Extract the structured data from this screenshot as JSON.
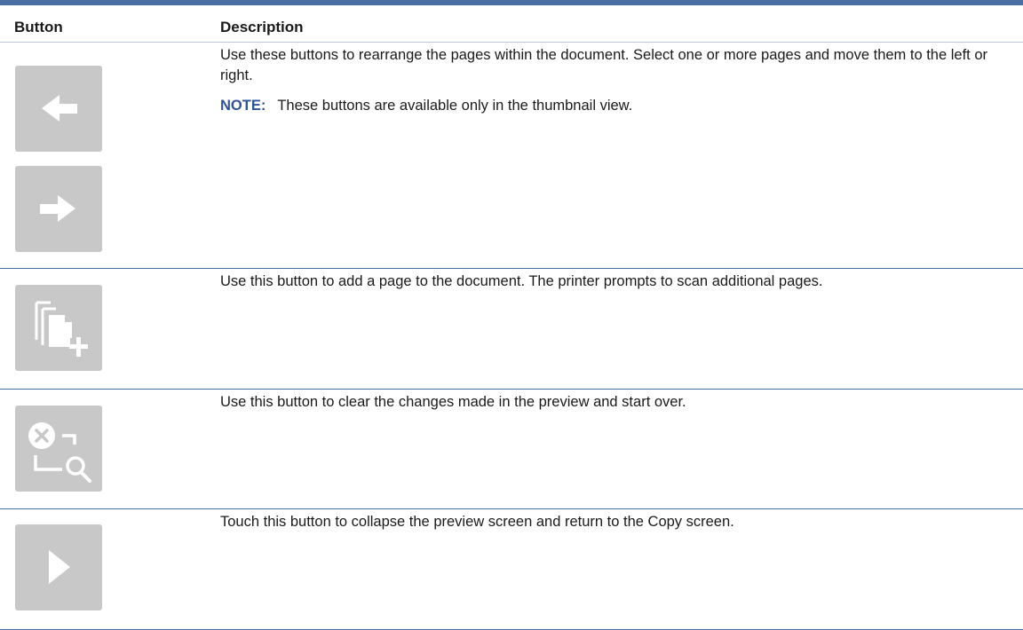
{
  "table": {
    "header": {
      "button_col": "Button",
      "description_col": "Description"
    },
    "rows": [
      {
        "icons": [
          "arrow-left-icon",
          "arrow-right-icon"
        ],
        "description": "Use these buttons to rearrange the pages within the document. Select one or more pages and move them to the left or right.",
        "note_label": "NOTE:",
        "note_text": "These buttons are available only in the thumbnail view."
      },
      {
        "icons": [
          "add-page-icon"
        ],
        "description": "Use this button to add a page to the document. The printer prompts to scan additional pages."
      },
      {
        "icons": [
          "reset-preview-icon"
        ],
        "description": "Use this button to clear the changes made in the preview and start over."
      },
      {
        "icons": [
          "collapse-play-icon"
        ],
        "description": "Touch this button to collapse the preview screen and return to the Copy screen."
      }
    ]
  },
  "colors": {
    "accent_rule": "#4a6fa5",
    "note_label": "#2f5496",
    "tile_bg": "#c8c8c8",
    "tile_glyph": "#ffffff"
  }
}
